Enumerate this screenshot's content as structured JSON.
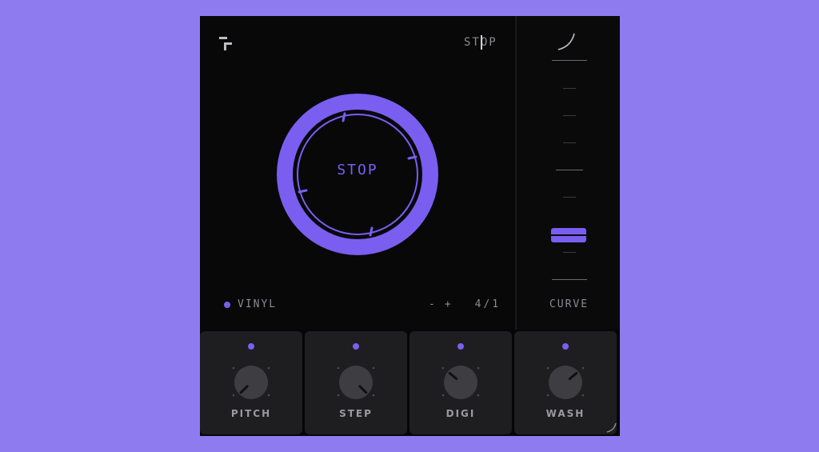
{
  "header": {
    "mode_display": "STOP"
  },
  "dial": {
    "center_text": "STOP"
  },
  "footer": {
    "vinyl_label": "VINYL",
    "speed_minus": "-",
    "speed_plus": "+",
    "speed_value": "4/1"
  },
  "side_panel": {
    "curve_label": "CURVE",
    "curve_level": 0.2
  },
  "knobs": [
    {
      "label": "PITCH",
      "angle": -135
    },
    {
      "label": "STEP",
      "angle": 135
    },
    {
      "label": "DIGI",
      "angle": -50
    },
    {
      "label": "WASH",
      "angle": 50
    }
  ],
  "colors": {
    "accent": "#7a5ef0",
    "background": "#8f7bf0",
    "panel": "#080809",
    "card": "#1e1e20"
  },
  "icons": {
    "logo": "brand-logo-icon",
    "curve": "curve-icon",
    "resize": "resize-handle-icon"
  }
}
